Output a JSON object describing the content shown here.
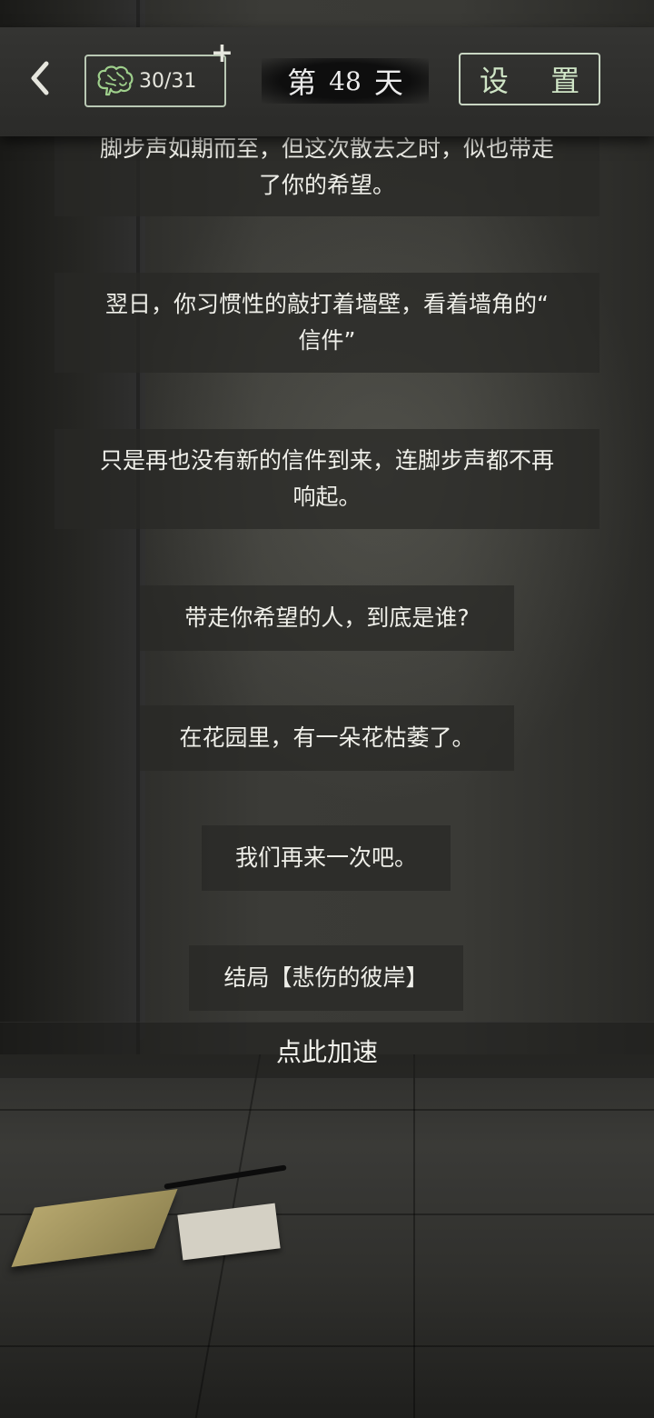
{
  "header": {
    "brain_count": "30/31",
    "plus_label": "+",
    "day_prefix": "第",
    "day_number": "48",
    "day_suffix": "天",
    "settings_label": "设 置"
  },
  "messages": [
    {
      "text_line1": "脚步声如期而至，但这次散去之时，似也带走",
      "text_line2": "了你的希望。"
    },
    {
      "text_line1": "翌日，你习惯性的敲打着墙壁，看着墙角的“",
      "text_line2": "信件”"
    },
    {
      "text_line1": "只是再也没有新的信件到来，连脚步声都不再",
      "text_line2": "响起。"
    }
  ],
  "choices": [
    "带走你希望的人，到底是谁?",
    "在花园里，有一朵花枯萎了。",
    "我们再来一次吧。",
    "结局【悲伤的彼岸】"
  ],
  "speed_up_label": "点此加速",
  "icons": {
    "back": "chevron-left-icon",
    "brain": "brain-icon"
  },
  "colors": {
    "accent_green": "#cfe5c6",
    "panel": "#2b2b29"
  }
}
